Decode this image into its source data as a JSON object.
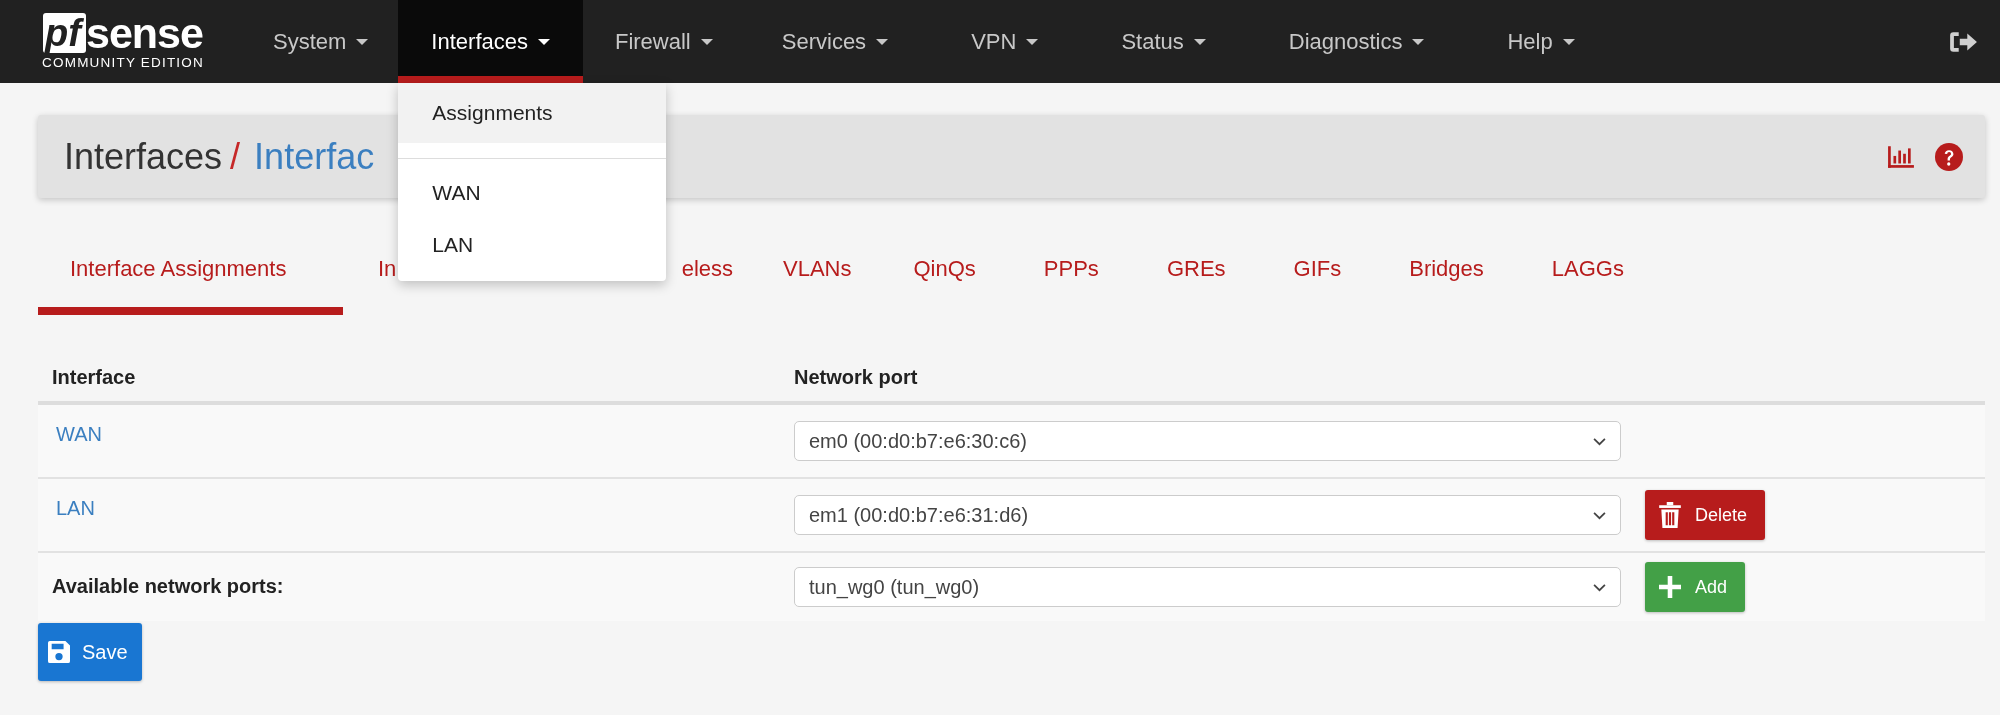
{
  "logo": {
    "mark": "pf",
    "name": "sense",
    "edition": "COMMUNITY EDITION"
  },
  "nav": [
    {
      "label": "System",
      "selected": false
    },
    {
      "label": "Interfaces",
      "selected": true
    },
    {
      "label": "Firewall",
      "selected": false
    },
    {
      "label": "Services",
      "selected": false
    },
    {
      "label": "VPN",
      "selected": false
    },
    {
      "label": "Status",
      "selected": false
    },
    {
      "label": "Diagnostics",
      "selected": false
    },
    {
      "label": "Help",
      "selected": false
    }
  ],
  "dropdown": {
    "groups": [
      {
        "items": [
          {
            "label": "Assignments",
            "selected": true
          }
        ]
      },
      {
        "items": [
          {
            "label": "WAN",
            "selected": false
          },
          {
            "label": "LAN",
            "selected": false
          }
        ]
      }
    ]
  },
  "breadcrumb": {
    "section": "Interfaces",
    "separator": "/",
    "page": "Interfac"
  },
  "tabs": [
    {
      "label": "Interface Assignments",
      "selected": true
    },
    {
      "label": "In",
      "selected": false
    },
    {
      "label": "eless",
      "selected": false
    },
    {
      "label": "VLANs",
      "selected": false
    },
    {
      "label": "QinQs",
      "selected": false
    },
    {
      "label": "PPPs",
      "selected": false
    },
    {
      "label": "GREs",
      "selected": false
    },
    {
      "label": "GIFs",
      "selected": false
    },
    {
      "label": "Bridges",
      "selected": false
    },
    {
      "label": "LAGGs",
      "selected": false
    }
  ],
  "table": {
    "columns": [
      "Interface",
      "Network port"
    ],
    "rows": [
      {
        "kind": "link",
        "interface": "WAN",
        "port": "em0 (00:d0:b7:e6:30:c6)"
      },
      {
        "kind": "link",
        "interface": "LAN",
        "port": "em1 (00:d0:b7:e6:31:d6)",
        "action": {
          "kind": "delete",
          "label": "Delete"
        }
      },
      {
        "kind": "label",
        "interface": "Available network ports:",
        "port": "tun_wg0 (tun_wg0)",
        "action": {
          "kind": "add",
          "label": "Add"
        }
      }
    ]
  },
  "save_button": {
    "label": "Save"
  }
}
